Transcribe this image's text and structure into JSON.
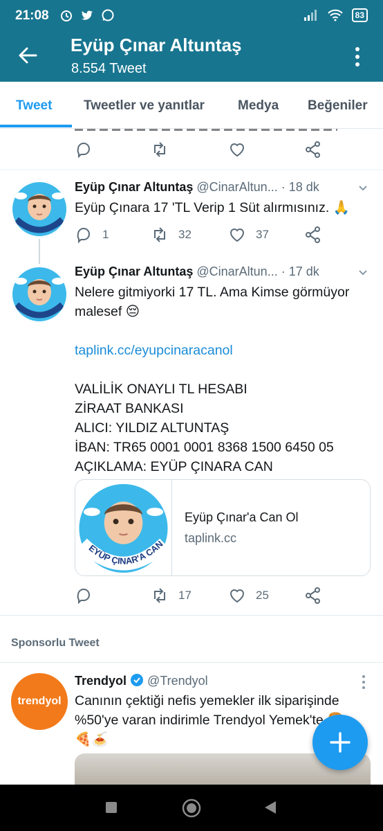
{
  "status_bar": {
    "time": "21:08",
    "battery": "83"
  },
  "app_bar": {
    "title": "Eyüp Çınar Altuntaş",
    "subtitle": "8.554 Tweet",
    "color": "#18758f"
  },
  "tabs": [
    {
      "label": "Tweet",
      "active": true
    },
    {
      "label": "Tweetler ve yanıtlar",
      "active": false
    },
    {
      "label": "Medya",
      "active": false
    },
    {
      "label": "Beğeniler",
      "active": false
    }
  ],
  "tweets": [
    {
      "name": "Eyüp Çınar Altuntaş",
      "handle": "@CinarAltun...",
      "dot": "·",
      "time": "18 dk",
      "text": "Eyüp Çınara 17 'TL Verip 1 Süt alırmısınız. 🙏",
      "replies": "1",
      "retweets": "32",
      "likes": "37"
    },
    {
      "name": "Eyüp Çınar Altuntaş",
      "handle": "@CinarAltun...",
      "dot": "·",
      "time": "17 dk",
      "text_line1": "Nelere gitmiyorki 17 TL. Ama Kimse görmüyor",
      "text_line2": "malesef 😔",
      "link": "taplink.cc/eyupcinaracanol",
      "bank_lines": [
        "VALİLİK ONAYLI TL HESABI",
        "ZİRAAT BANKASI",
        "ALICI: YILDIZ ALTUNTAŞ",
        "İBAN: TR65 0001 0001 8368 1500 6450 05",
        "AÇIKLAMA: EYÜP ÇINARA CAN"
      ],
      "card": {
        "title": "Eyüp Çınar'a Can Ol",
        "domain": "taplink.cc",
        "badge_text": "EYÜP ÇINAR'A CAN OL!"
      },
      "replies": "",
      "retweets": "17",
      "likes": "25"
    }
  ],
  "sponsored": {
    "label": "Sponsorlu Tweet",
    "name": "Trendyol",
    "handle": "@Trendyol",
    "avatar_text": "trendyol",
    "text_line1": "Canının çektiği nefis yemekler ilk siparişinde",
    "text_line2": "%50'ye varan indirimle Trendyol Yemek'te 🍔",
    "text_line3": "🍕🍝"
  },
  "colors": {
    "accent": "#1d9bf0",
    "link": "#1a8cd8",
    "trendyol": "#f27a1a"
  }
}
